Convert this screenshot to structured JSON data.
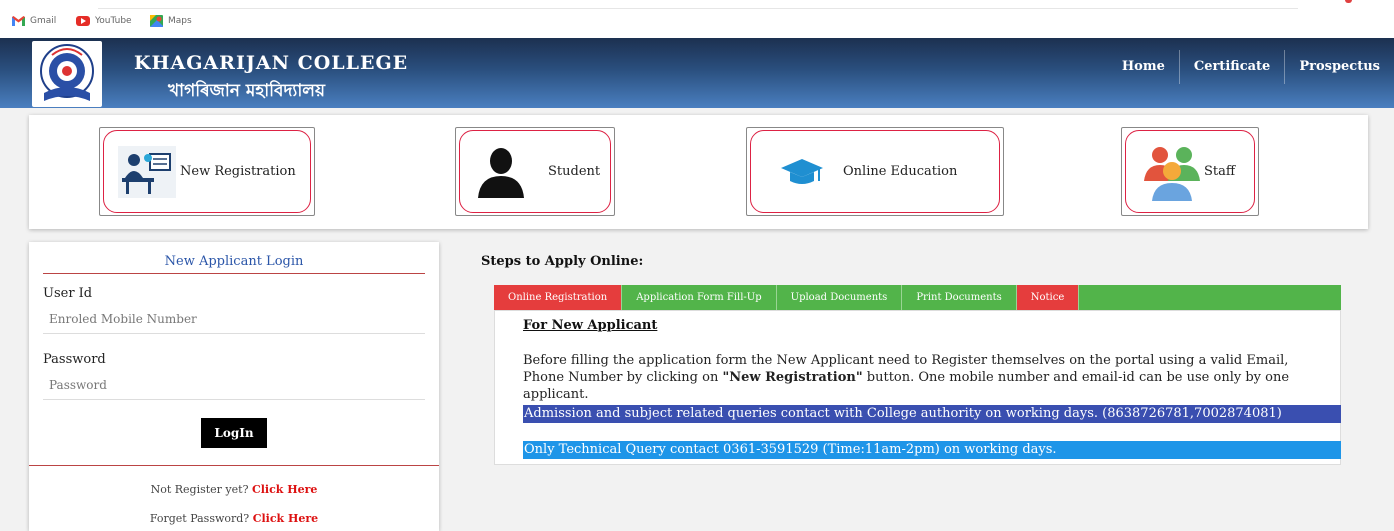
{
  "bookmarks": [
    {
      "label": "Gmail",
      "icon": "gmail-icon"
    },
    {
      "label": "YouTube",
      "icon": "youtube-icon"
    },
    {
      "label": "Maps",
      "icon": "maps-icon"
    }
  ],
  "header": {
    "title_en": "KHAGARIJAN COLLEGE",
    "title_bn": "খাগৰিজান মহাবিদ্যালয়",
    "nav": [
      "Home",
      "Certificate",
      "Prospectus"
    ]
  },
  "tiles": [
    {
      "label": "New Registration",
      "icon": "registration-desk-icon"
    },
    {
      "label": "Student",
      "icon": "person-silhouette-icon"
    },
    {
      "label": "Online Education",
      "icon": "graduation-cap-icon"
    },
    {
      "label": "Staff",
      "icon": "group-users-icon"
    }
  ],
  "login": {
    "title": "New Applicant Login",
    "user_label": "User Id",
    "user_placeholder": "Enroled Mobile Number",
    "password_label": "Password",
    "password_placeholder": "Password",
    "button": "LogIn",
    "not_registered_text": "Not Register yet?",
    "not_registered_link": "Click Here",
    "forget_text": "Forget Password?",
    "forget_link": "Click Here"
  },
  "steps": {
    "title": "Steps to Apply Online:",
    "tabs": [
      "Online Registration",
      "Application Form Fill-Up",
      "Upload Documents",
      "Print Documents",
      "Notice"
    ],
    "subhead": "For New Applicant",
    "para_before": "Before filling the application form the New Applicant need to Register themselves on the portal using a valid Email, Phone Number by clicking on ",
    "para_bold": "\"New Registration\"",
    "para_after": " button. One mobile number and email-id can be use only by one applicant.",
    "notice_admission": "Admission and subject related queries contact with College authority on working days. (8638726781,7002874081)",
    "notice_technical": "Only Technical Query contact 0361-3591529 (Time:11am-2pm) on working days."
  },
  "colors": {
    "header_dark": "#1c3050",
    "header_light": "#4a7fc0",
    "tab_green": "#52b44a",
    "tab_red": "#e53d3d",
    "notice_blue": "#3a4fb0",
    "notice_cyan": "#1e95e8",
    "link_red": "#dd1111"
  }
}
